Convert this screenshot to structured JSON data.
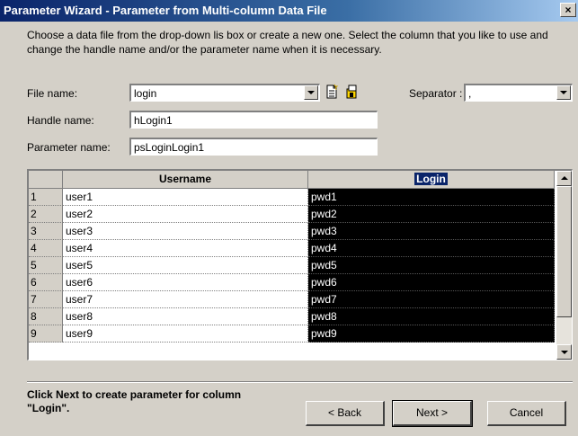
{
  "window": {
    "title": "Parameter Wizard - Parameter from Multi-column Data File",
    "close": "×"
  },
  "instructions": "Choose a data file from the drop-down lis box or create a new one. Select the column that you like to use and change the  handle name and/or the parameter name when it is necessary.",
  "form": {
    "file_label": "File name:",
    "file_value": "login",
    "separator_label": "Separator :",
    "separator_value": ",",
    "handle_label": "Handle name:",
    "handle_value": "hLogin1",
    "param_label": "Parameter name:",
    "param_value": "psLoginLogin1"
  },
  "grid": {
    "columns": [
      "",
      "Username",
      "Login"
    ],
    "selected_column": "Login",
    "rows": [
      [
        "1",
        "user1",
        "pwd1"
      ],
      [
        "2",
        "user2",
        "pwd2"
      ],
      [
        "3",
        "user3",
        "pwd3"
      ],
      [
        "4",
        "user4",
        "pwd4"
      ],
      [
        "5",
        "user5",
        "pwd5"
      ],
      [
        "6",
        "user6",
        "pwd6"
      ],
      [
        "7",
        "user7",
        "pwd7"
      ],
      [
        "8",
        "user8",
        "pwd8"
      ],
      [
        "9",
        "user9",
        "pwd9"
      ]
    ]
  },
  "footer": {
    "hint": "Click Next to create parameter for column \"Login\".",
    "back": "< Back",
    "next": "Next >",
    "cancel": "Cancel"
  },
  "icons": {
    "new_file": "new-file-icon",
    "open_file": "open-file-icon"
  }
}
